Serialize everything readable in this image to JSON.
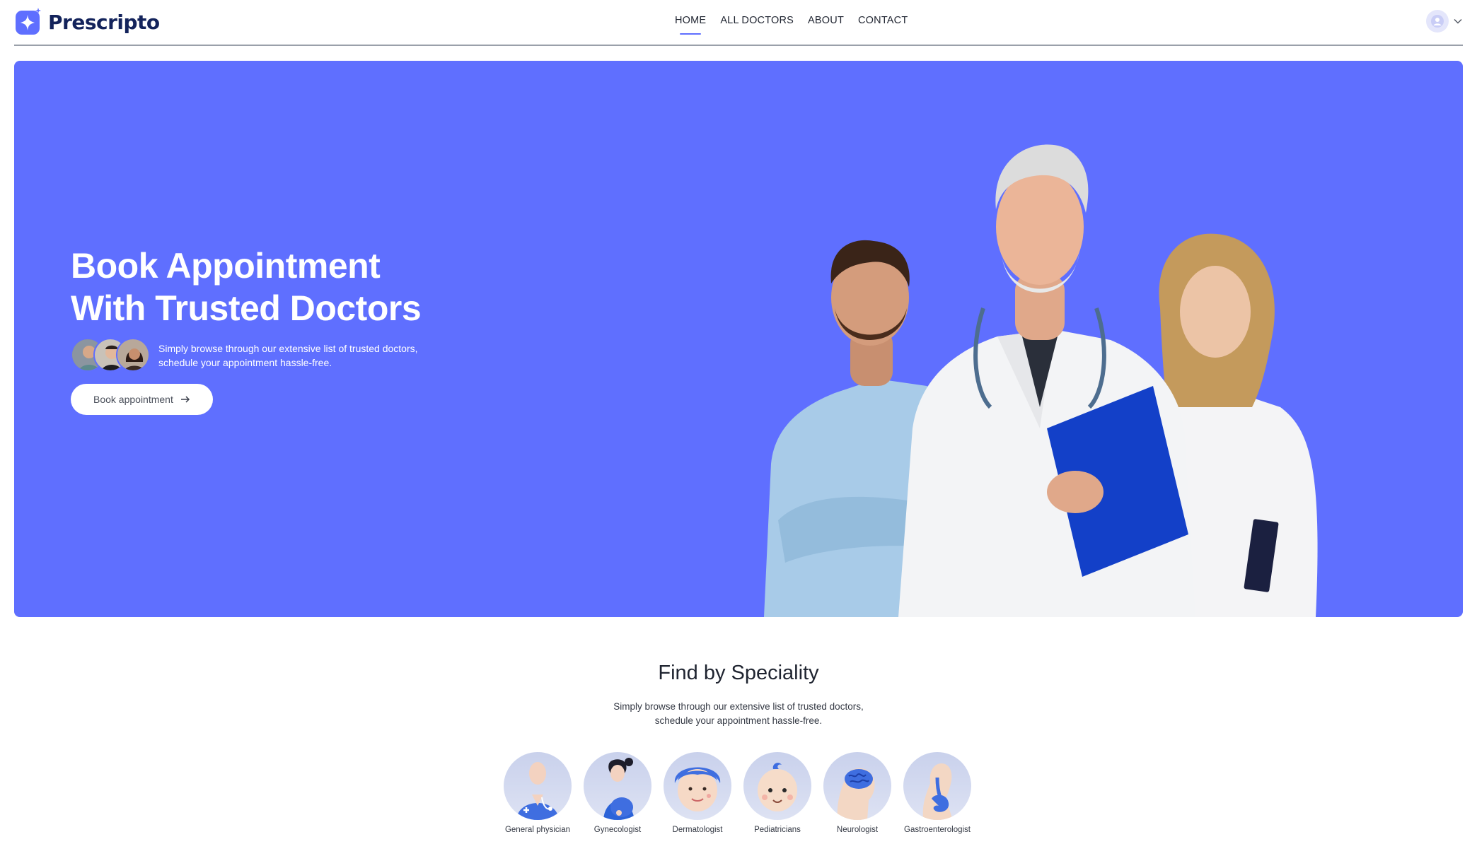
{
  "brand": {
    "name": "Prescripto",
    "accent": "#5f6fff",
    "logo_icon": "star-cross-logo-icon"
  },
  "nav": {
    "links": [
      {
        "label": "HOME",
        "active": true
      },
      {
        "label": "ALL DOCTORS",
        "active": false
      },
      {
        "label": "ABOUT",
        "active": false
      },
      {
        "label": "CONTACT",
        "active": false
      }
    ],
    "profile_icon": "user-avatar-icon",
    "dropdown_icon": "chevron-down-icon"
  },
  "hero": {
    "title_line1": "Book Appointment",
    "title_line2": "With Trusted Doctors",
    "subtitle_line1": "Simply browse through our extensive list of trusted doctors,",
    "subtitle_line2": "schedule your appointment hassle-free.",
    "button_label": "Book appointment",
    "button_icon": "arrow-right-icon",
    "background": "#5f6fff"
  },
  "speciality": {
    "title": "Find by Speciality",
    "subtitle_line1": "Simply browse through our extensive list of trusted doctors,",
    "subtitle_line2": "schedule your appointment hassle-free.",
    "items": [
      {
        "label": "General physician",
        "icon": "general-physician-icon"
      },
      {
        "label": "Gynecologist",
        "icon": "gynecologist-icon"
      },
      {
        "label": "Dermatologist",
        "icon": "dermatologist-icon"
      },
      {
        "label": "Pediatricians",
        "icon": "pediatrician-icon"
      },
      {
        "label": "Neurologist",
        "icon": "neurologist-icon"
      },
      {
        "label": "Gastroenterologist",
        "icon": "gastroenterologist-icon"
      }
    ]
  }
}
